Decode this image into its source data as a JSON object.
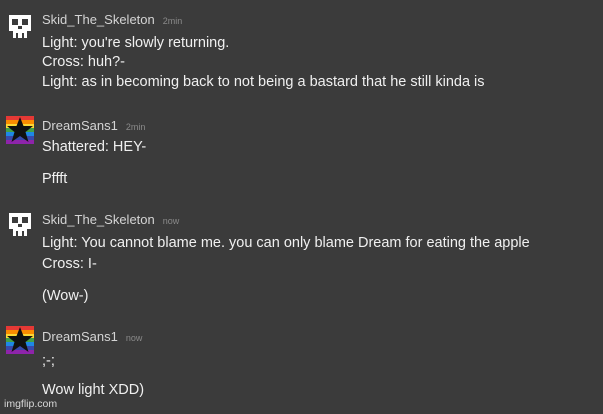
{
  "chat": {
    "messages": [
      {
        "username": "Skid_The_Skeleton",
        "timestamp": "2min",
        "avatar": "skull-icon",
        "lines": [
          "Light: you're slowly returning.",
          "Cross: huh?-",
          "Light: as in becoming back to not being a bastard that he still kinda is"
        ]
      },
      {
        "username": "DreamSans1",
        "timestamp": "2min",
        "avatar": "rainbow-star-icon",
        "lines": [
          "Shattered: HEY-",
          "Pffft"
        ]
      },
      {
        "username": "Skid_The_Skeleton",
        "timestamp": "now",
        "avatar": "skull-icon",
        "lines": [
          "Light: You cannot blame me. you can only blame Dream for eating the apple",
          "Cross: I-",
          "(Wow-)"
        ]
      },
      {
        "username": "DreamSans1",
        "timestamp": "now",
        "avatar": "rainbow-star-icon",
        "lines": [
          ";-;",
          "Wow light XDD)"
        ]
      }
    ]
  },
  "watermark": "imgflip.com",
  "colors": {
    "background": "#3b3b3b",
    "username": "#d4d4d4",
    "timestamp": "#8a8a8a",
    "message_text": "#f0f0f0"
  }
}
